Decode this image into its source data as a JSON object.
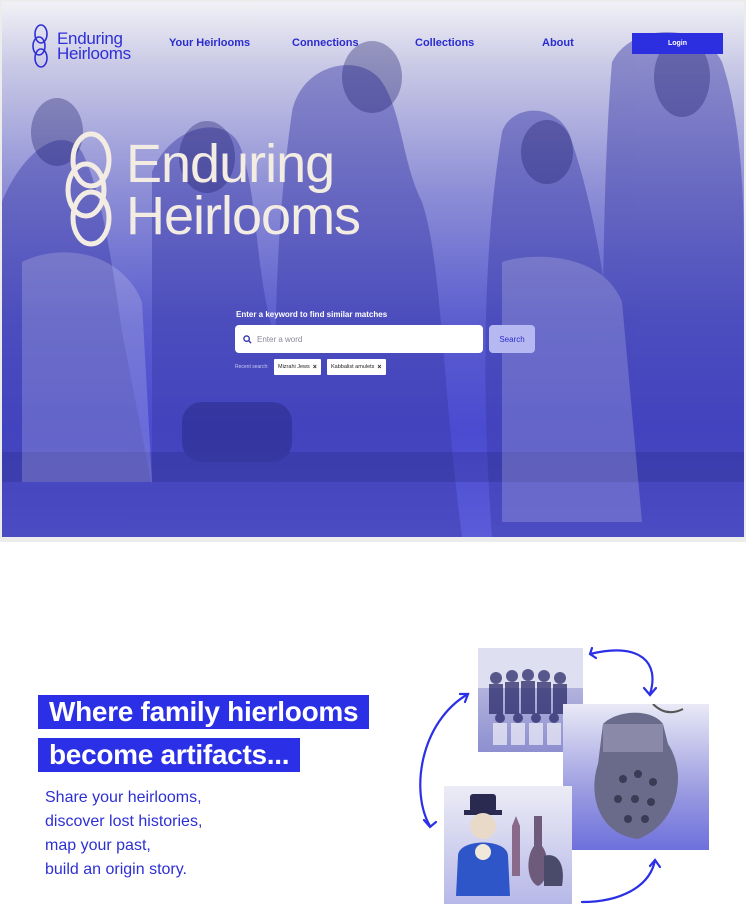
{
  "header": {
    "brand_line1": "Enduring",
    "brand_line2": "Heirlooms",
    "nav": [
      {
        "label": "Your Heirlooms"
      },
      {
        "label": "Connections"
      },
      {
        "label": "Collections"
      },
      {
        "label": "About"
      }
    ],
    "login_label": "Login"
  },
  "hero": {
    "title_line1": "Enduring",
    "title_line2": "Heirlooms",
    "search_label": "Enter a keyword to find similar matches",
    "search_placeholder": "Enter a word",
    "search_button": "Search",
    "recent_label": "Recent search:",
    "recent_searches": [
      "Mizrahi Jews",
      "Kabbalist amulets"
    ]
  },
  "intro": {
    "headline_line1": "Where family hierlooms",
    "headline_line2": "become artifacts...",
    "lines": [
      "Share your heirlooms,",
      "discover lost histories,",
      "map your past,",
      "build an origin story."
    ]
  },
  "colors": {
    "accent": "#2b2fe6",
    "hero_tint": "#4a4bd0",
    "cream": "#f2ece2"
  }
}
